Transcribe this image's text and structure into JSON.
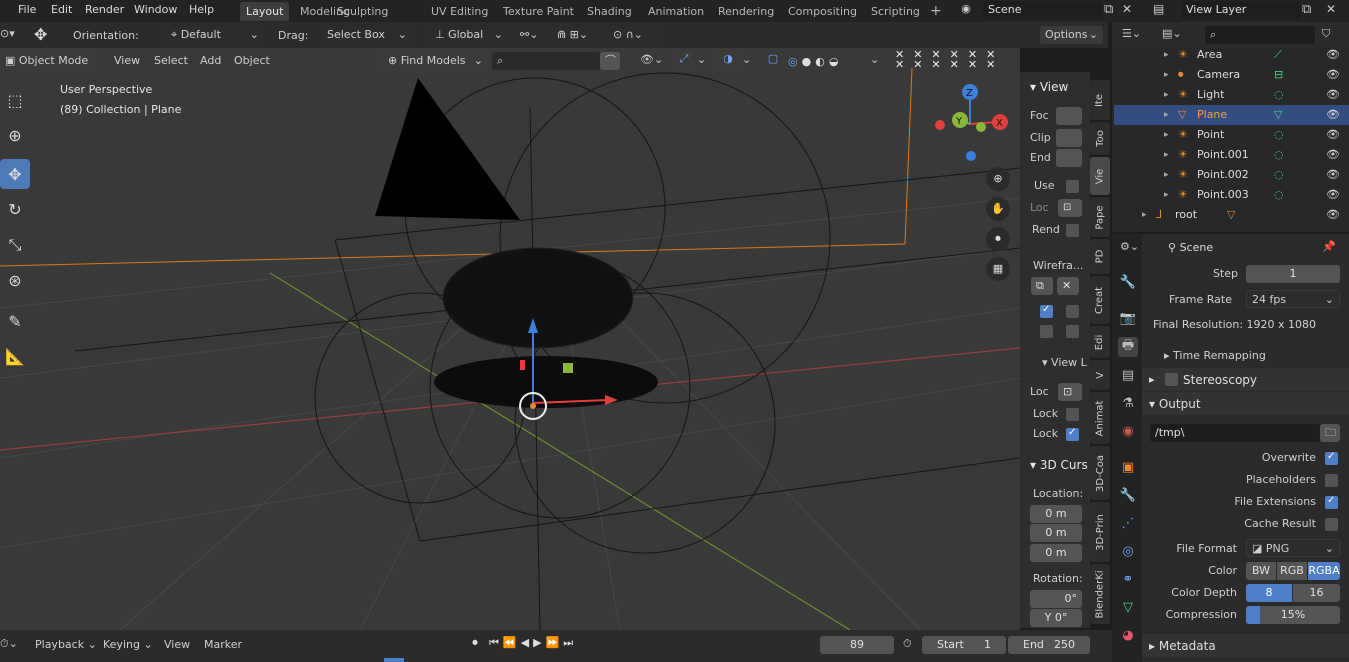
{
  "topbar": {
    "menus": [
      "File",
      "Edit",
      "Render",
      "Window",
      "Help"
    ],
    "workspaces": [
      "Layout",
      "Modeling",
      "Sculpting",
      "UV Editing",
      "Texture Paint",
      "Shading",
      "Animation",
      "Rendering",
      "Compositing",
      "Scripting"
    ],
    "active_workspace": "Layout",
    "add_tab": "+",
    "scene": "Scene",
    "view_layer": "View Layer"
  },
  "tool_header": {
    "orientation_label": "Orientation:",
    "orientation_value": "Default",
    "drag_label": "Drag:",
    "drag_value": "Select Box",
    "transform_orientation": "Global",
    "options": "Options"
  },
  "viewport_header": {
    "mode": "Object Mode",
    "menus": [
      "View",
      "Select",
      "Add",
      "Object"
    ],
    "find_models": "Find Models"
  },
  "viewport": {
    "perspective": "User Perspective",
    "collection_info": "(89) Collection | Plane",
    "gizmo_axes": {
      "z": "Z",
      "y": "Y",
      "x": "X"
    }
  },
  "npanel": {
    "view_header": "View",
    "focal_label": "Foc",
    "clip_label": "Clip",
    "end_label": "End",
    "use_label": "Use",
    "loc_label": "Loc",
    "rend_label": "Rend",
    "wireframe_label": "Wirefra...",
    "view_lock_header": "View L",
    "loc2_label": "Loc",
    "lock1_label": "Lock",
    "lock2_label": "Lock",
    "cursor_header": "3D Curs",
    "location_label": "Location:",
    "loc_x": "0 m",
    "loc_y": "0 m",
    "loc_z": "0 m",
    "rotation_label": "Rotation:",
    "rot_x": "0°",
    "rot_y": "Y 0°",
    "tabs": [
      "Ite",
      "Too",
      "Vie",
      "Pape",
      "PD",
      "Creat",
      "Edi",
      "V",
      "Animat",
      "3D-Coa",
      "3D-Prin",
      "BlenderKi"
    ],
    "active_tab": "Vie"
  },
  "outliner": {
    "rows": [
      {
        "name": "Area",
        "selected": false
      },
      {
        "name": "Camera",
        "selected": false
      },
      {
        "name": "Light",
        "selected": false
      },
      {
        "name": "Plane",
        "selected": true
      },
      {
        "name": "Point",
        "selected": false
      },
      {
        "name": "Point.001",
        "selected": false
      },
      {
        "name": "Point.002",
        "selected": false
      },
      {
        "name": "Point.003",
        "selected": false
      },
      {
        "name": "root",
        "selected": false
      }
    ]
  },
  "properties": {
    "scene_name": "Scene",
    "step_label": "Step",
    "step_value": "1",
    "frame_rate_label": "Frame Rate",
    "frame_rate_value": "24 fps",
    "final_resolution": "Final Resolution: 1920 x 1080",
    "time_remapping": "Time Remapping",
    "stereoscopy": "Stereoscopy",
    "output": "Output",
    "output_path": "/tmp\\",
    "overwrite": "Overwrite",
    "placeholders": "Placeholders",
    "file_extensions": "File Extensions",
    "cache_result": "Cache Result",
    "file_format_label": "File Format",
    "file_format_value": "PNG",
    "color_label": "Color",
    "color_options": [
      "BW",
      "RGB",
      "RGBA"
    ],
    "color_active": "RGBA",
    "color_depth_label": "Color Depth",
    "color_depth_options": [
      "8",
      "16"
    ],
    "color_depth_active": "8",
    "compression_label": "Compression",
    "compression_value": "15%",
    "compression_fraction": 0.15,
    "metadata": "Metadata"
  },
  "timeline": {
    "menus": [
      "Playback",
      "Keying",
      "View",
      "Marker"
    ],
    "current_frame": "89",
    "start_label": "Start",
    "start_value": "1",
    "end_label": "End",
    "end_value": "250"
  },
  "colors": {
    "accent": "#4f7fc9",
    "selected_row": "#334d80",
    "x_axis": "#e2403f",
    "y_axis": "#8ab63c",
    "z_axis": "#3d7fdd",
    "camera_line": "#e88a2e"
  }
}
